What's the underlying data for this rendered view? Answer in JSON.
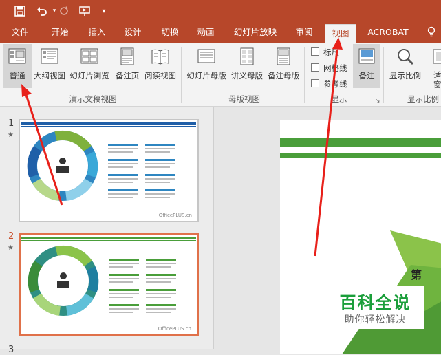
{
  "tabs": [
    {
      "label": "文件",
      "active": false
    },
    {
      "label": "开始",
      "active": false
    },
    {
      "label": "插入",
      "active": false
    },
    {
      "label": "设计",
      "active": false
    },
    {
      "label": "切换",
      "active": false
    },
    {
      "label": "动画",
      "active": false
    },
    {
      "label": "幻灯片放映",
      "active": false
    },
    {
      "label": "审阅",
      "active": false
    },
    {
      "label": "视图",
      "active": true
    },
    {
      "label": "ACROBAT",
      "active": false
    }
  ],
  "ribbon": {
    "presentation_views": {
      "group_label": "演示文稿视图",
      "normal": "普通",
      "outline": "大纲视图",
      "slide_sorter": "幻灯片浏览",
      "notes_page": "备注页",
      "reading_view": "阅读视图"
    },
    "master_views": {
      "group_label": "母版视图",
      "slide_master": "幻灯片母版",
      "handout_master": "讲义母版",
      "notes_master": "备注母版"
    },
    "show": {
      "group_label": "显示",
      "ruler": "标尺",
      "gridlines": "网格线",
      "guides": "参考线",
      "notes": "备注"
    },
    "zoom": {
      "group_label": "显示比例",
      "zoom": "显示比例",
      "fit": "适应窗口"
    }
  },
  "slides": [
    {
      "number": "1",
      "brand": "OfficePLUS.cn"
    },
    {
      "number": "2",
      "brand": "OfficePLUS.cn"
    },
    {
      "number": "3"
    }
  ],
  "watermark": {
    "title": "百科全说",
    "subtitle": "助你轻松解决"
  },
  "colors": {
    "accent": "#b7472a",
    "selected_border": "#e0714a",
    "slide_green": "#4a9e3a"
  }
}
